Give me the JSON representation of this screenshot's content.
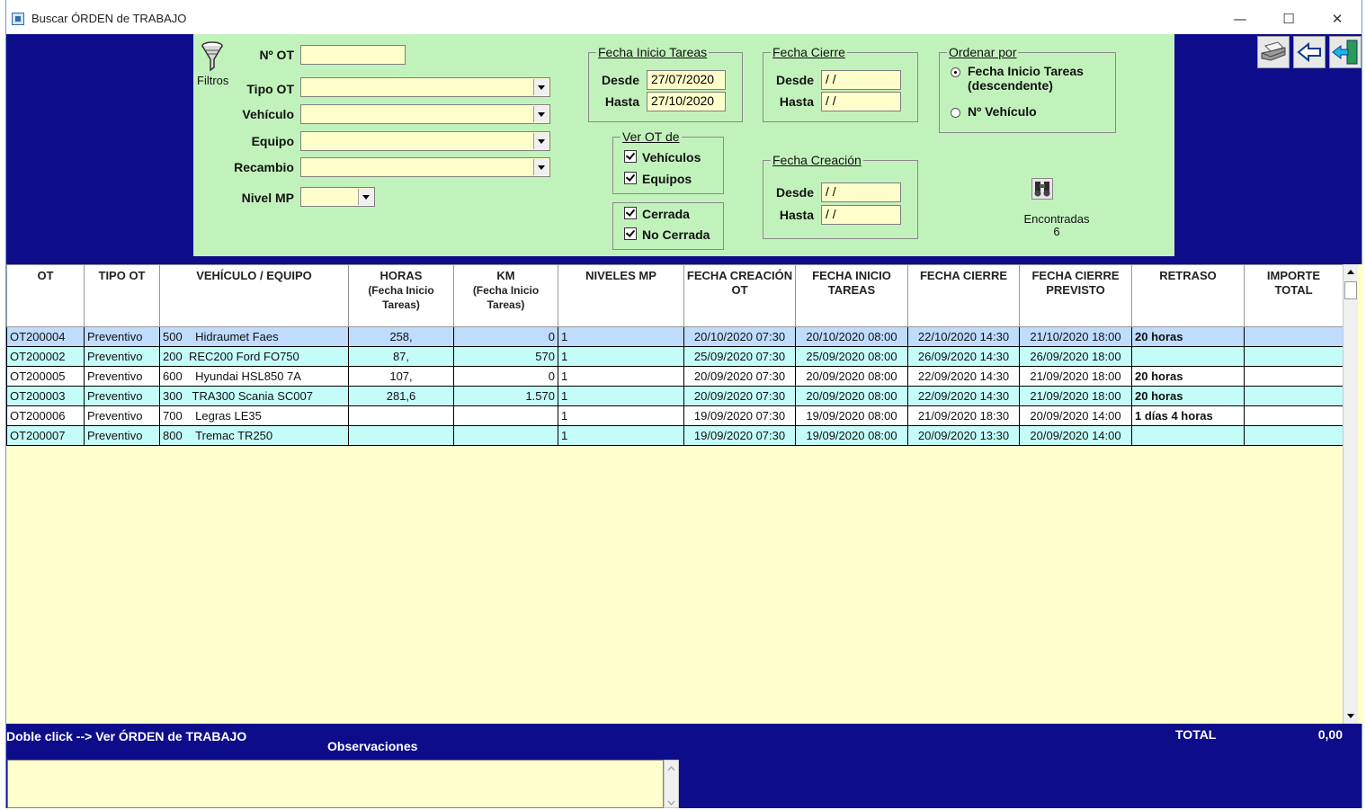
{
  "window": {
    "title": "Buscar ÓRDEN de TRABAJO",
    "minimize": "—",
    "maximize": "☐",
    "close": "✕"
  },
  "filters": {
    "icon_label": "Filtros",
    "no_ot_label": "Nº OT",
    "no_ot_value": "",
    "tipo_ot_label": "Tipo OT",
    "tipo_ot_value": "",
    "vehiculo_label": "Vehículo",
    "vehiculo_value": "",
    "equipo_label": "Equipo",
    "equipo_value": "",
    "recambio_label": "Recambio",
    "recambio_value": "",
    "nivel_mp_label": "Nivel MP",
    "nivel_mp_value": ""
  },
  "fecha_inicio": {
    "title": "Fecha Inicio Tareas",
    "desde_label": "Desde",
    "desde_value": "27/07/2020",
    "hasta_label": "Hasta",
    "hasta_value": "27/10/2020"
  },
  "fecha_cierre": {
    "title": "Fecha Cierre",
    "desde_label": "Desde",
    "desde_value": " / /",
    "hasta_label": "Hasta",
    "hasta_value": " / /"
  },
  "fecha_creacion": {
    "title": "Fecha Creación",
    "desde_label": "Desde",
    "desde_value": " / /",
    "hasta_label": "Hasta",
    "hasta_value": " / /"
  },
  "ordenar": {
    "title": "Ordenar por",
    "option1_line1": "Fecha Inicio Tareas",
    "option1_line2": "(descendente)",
    "option2": "Nº Vehículo"
  },
  "ver_ot": {
    "title": "Ver OT de",
    "vehiculos": "Vehículos",
    "equipos": "Equipos"
  },
  "estado": {
    "cerrada": "Cerrada",
    "no_cerrada": "No Cerrada"
  },
  "found": {
    "label": "Encontradas",
    "count": "6"
  },
  "grid": {
    "headers": {
      "ot": "OT",
      "tipo": "TIPO OT",
      "veh": "VEHÍCULO / EQUIPO",
      "horas": "HORAS",
      "horas_sub1": "(Fecha Inicio",
      "horas_sub2": "Tareas)",
      "km": "KM",
      "km_sub1": "(Fecha Inicio",
      "km_sub2": "Tareas)",
      "niveles": "NIVELES MP",
      "fcre1": "FECHA CREACIÓN",
      "fcre2": "OT",
      "fini1": "FECHA INICIO",
      "fini2": "TAREAS",
      "fcie": "FECHA CIERRE",
      "fprev1": "FECHA CIERRE",
      "fprev2": "PREVISTO",
      "retraso": "RETRASO",
      "imp1": "IMPORTE",
      "imp2": "TOTAL"
    },
    "rows": [
      {
        "ot": "OT200004",
        "tipo": "Preventivo",
        "veh_num": "500",
        "veh_name": "Hidraumet Faes",
        "horas": "258,",
        "km": "0",
        "niveles": "1",
        "fcre": "20/10/2020 07:30",
        "fini": "20/10/2020 08:00",
        "fcie": "22/10/2020 14:30",
        "fprev": "21/10/2020 18:00",
        "retraso": "20 horas",
        "importe": ""
      },
      {
        "ot": "OT200002",
        "tipo": "Preventivo",
        "veh_num": "200",
        "veh_name": "REC200 Ford FO750",
        "horas": "87,",
        "km": "570",
        "niveles": "1",
        "fcre": "25/09/2020 07:30",
        "fini": "25/09/2020 08:00",
        "fcie": "26/09/2020 14:30",
        "fprev": "26/09/2020 18:00",
        "retraso": "",
        "importe": ""
      },
      {
        "ot": "OT200005",
        "tipo": "Preventivo",
        "veh_num": "600",
        "veh_name": "Hyundai HSL850 7A",
        "horas": "107,",
        "km": "0",
        "niveles": "1",
        "fcre": "20/09/2020 07:30",
        "fini": "20/09/2020 08:00",
        "fcie": "22/09/2020 14:30",
        "fprev": "21/09/2020 18:00",
        "retraso": "20 horas",
        "importe": ""
      },
      {
        "ot": "OT200003",
        "tipo": "Preventivo",
        "veh_num": "300",
        "veh_name": "TRA300 Scania SC007",
        "horas": "281,6",
        "km": "1.570",
        "niveles": "1",
        "fcre": "20/09/2020 07:30",
        "fini": "20/09/2020 08:00",
        "fcie": "22/09/2020 14:30",
        "fprev": "21/09/2020 18:00",
        "retraso": "20 horas",
        "importe": ""
      },
      {
        "ot": "OT200006",
        "tipo": "Preventivo",
        "veh_num": "700",
        "veh_name": "Legras LE35",
        "horas": "",
        "km": "",
        "niveles": "1",
        "fcre": "19/09/2020 07:30",
        "fini": "19/09/2020 08:00",
        "fcie": "21/09/2020 18:30",
        "fprev": "20/09/2020 14:00",
        "retraso": "1 días 4 horas",
        "importe": ""
      },
      {
        "ot": "OT200007",
        "tipo": "Preventivo",
        "veh_num": "800",
        "veh_name": "Tremac TR250",
        "horas": "",
        "km": "",
        "niveles": "1",
        "fcre": "19/09/2020 07:30",
        "fini": "19/09/2020 08:00",
        "fcie": "20/09/2020 13:30",
        "fprev": "20/09/2020 14:00",
        "retraso": "",
        "importe": ""
      }
    ]
  },
  "footer": {
    "hint": "Doble click --> Ver ÓRDEN de TRABAJO",
    "obs_label": "Observaciones",
    "total_label": "TOTAL",
    "total_value": "0,00",
    "obs_value": ""
  },
  "colors": {
    "main_bg": "#0d0d8c",
    "panel_bg": "#c2f2bc",
    "input_bg": "#ffffcc",
    "row_selected": "#bfdcff",
    "row_alt": "#c4fdf8"
  }
}
